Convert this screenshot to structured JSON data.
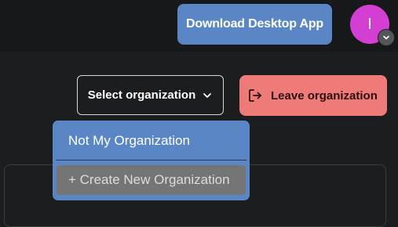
{
  "header": {
    "download_label": "Download Desktop App",
    "avatar_initial": "I"
  },
  "org_controls": {
    "select_label": "Select organization",
    "leave_label": "Leave organization"
  },
  "dropdown": {
    "items": [
      {
        "label": "Not My Organization"
      }
    ],
    "create_label": "+ Create New Organization"
  },
  "colors": {
    "accent_blue": "#5b86c6",
    "avatar_magenta": "#d33ed3",
    "danger_salmon": "#ee7b78"
  },
  "icons": {
    "select_caret": "chevron-down-icon",
    "leave": "logout-icon",
    "avatar_caret": "chevron-down-icon"
  }
}
